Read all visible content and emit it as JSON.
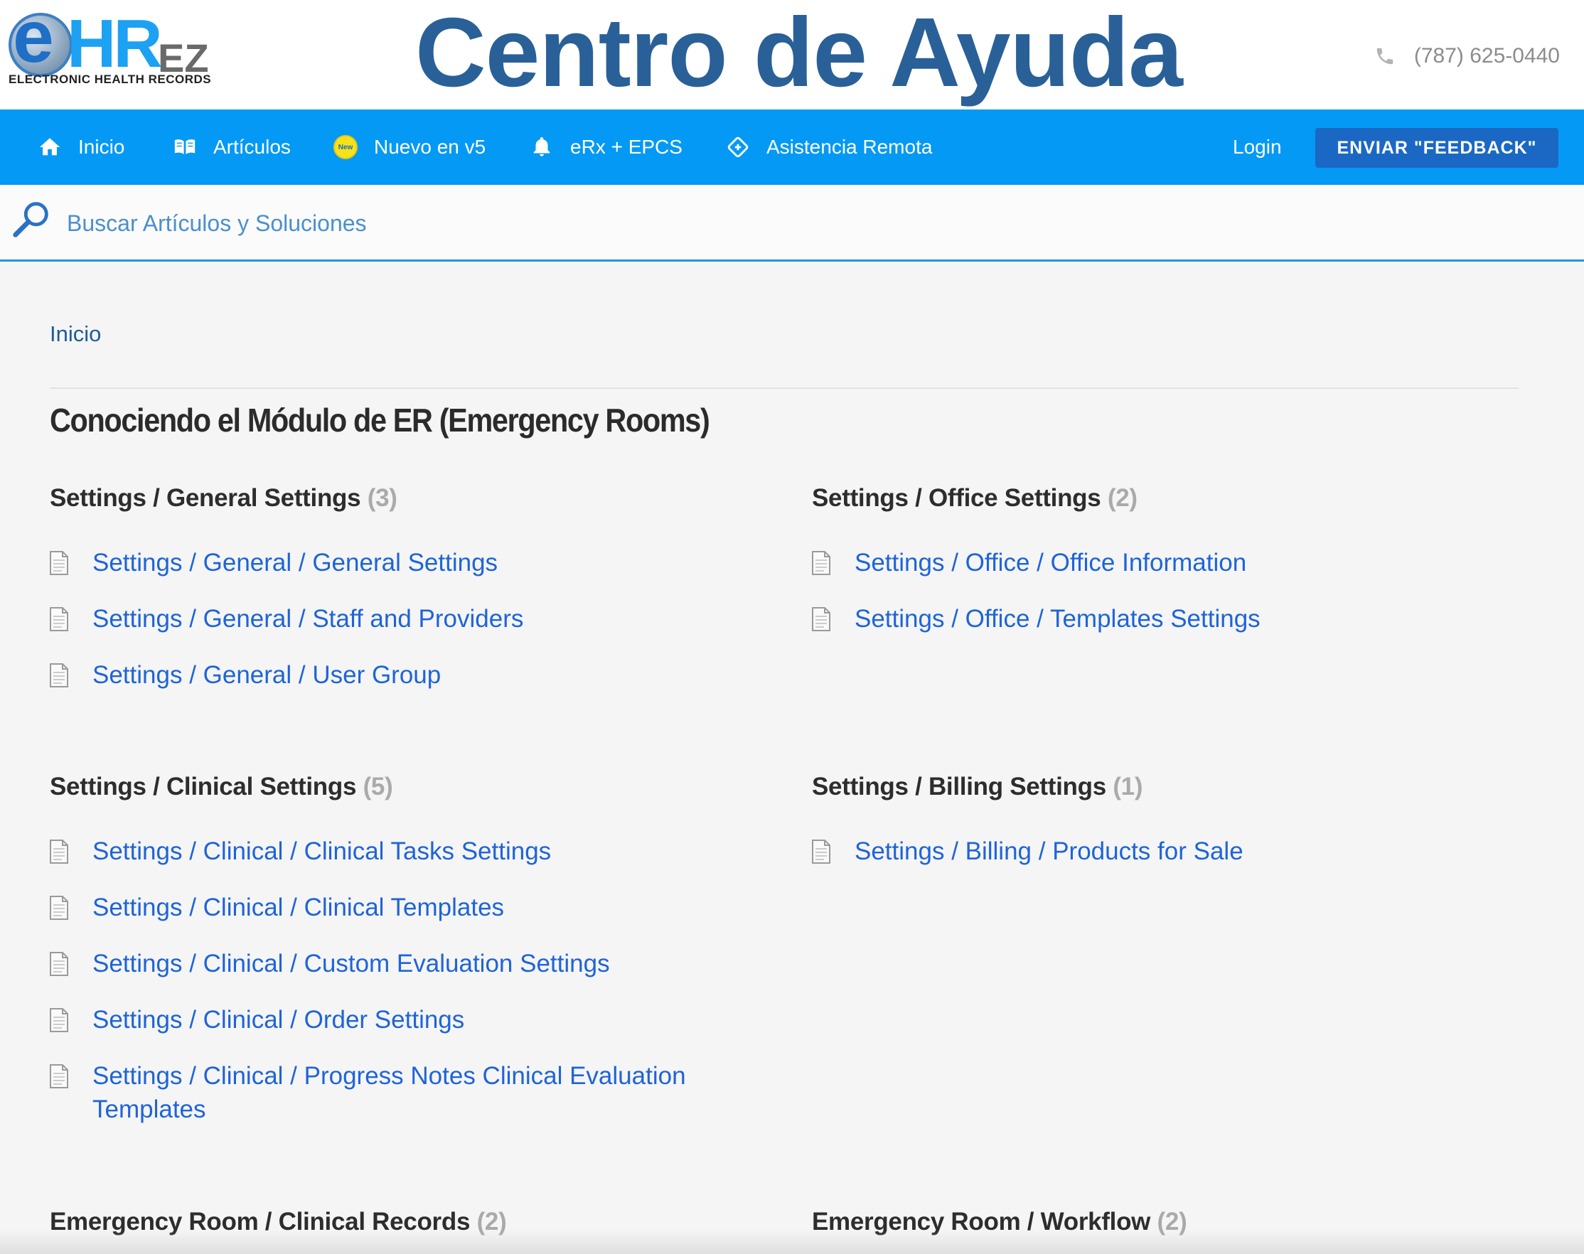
{
  "logo": {
    "e": "e",
    "hr": "HR",
    "ez": "EZ",
    "subtitle": "ELECTRONIC HEALTH RECORDS"
  },
  "header": {
    "title": "Centro de Ayuda",
    "phone": "(787) 625-0440"
  },
  "nav": {
    "items": [
      {
        "label": "Inicio",
        "icon": "home-icon"
      },
      {
        "label": "Artículos",
        "icon": "book-icon"
      },
      {
        "label": "Nuevo en v5",
        "icon": "new-badge-icon",
        "badge": "New"
      },
      {
        "label": "eRx + EPCS",
        "icon": "bell-icon"
      },
      {
        "label": "Asistencia Remota",
        "icon": "remote-icon"
      }
    ],
    "login": "Login",
    "feedback": "ENVIAR \"FEEDBACK\""
  },
  "search": {
    "placeholder": "Buscar Artículos y Soluciones"
  },
  "breadcrumb": "Inicio",
  "page_title": "Conociendo el Módulo de ER (Emergency Rooms)",
  "sections": [
    {
      "title": "Settings / General Settings",
      "count": "(3)",
      "articles": [
        "Settings / General / General Settings",
        "Settings / General / Staff and Providers",
        "Settings / General / User Group"
      ]
    },
    {
      "title": "Settings / Office Settings",
      "count": "(2)",
      "articles": [
        "Settings / Office / Office Information",
        "Settings / Office / Templates Settings"
      ]
    },
    {
      "title": "Settings / Clinical Settings",
      "count": "(5)",
      "articles": [
        "Settings / Clinical / Clinical Tasks Settings",
        "Settings / Clinical / Clinical Templates",
        "Settings / Clinical / Custom Evaluation Settings",
        "Settings / Clinical / Order Settings",
        "Settings / Clinical / Progress Notes Clinical Evaluation Templates"
      ]
    },
    {
      "title": "Settings / Billing Settings",
      "count": "(1)",
      "articles": [
        "Settings / Billing / Products for Sale"
      ]
    },
    {
      "title": "Emergency Room / Clinical Records",
      "count": "(2)",
      "articles": []
    },
    {
      "title": "Emergency Room / Workflow",
      "count": "(2)",
      "articles": []
    }
  ],
  "colors": {
    "nav_bg": "#0499f4",
    "feedback_bg": "#1b68c4",
    "title_blue": "#2a6098",
    "link_blue": "#1e64d8",
    "count_gray": "#aaaaaa"
  }
}
